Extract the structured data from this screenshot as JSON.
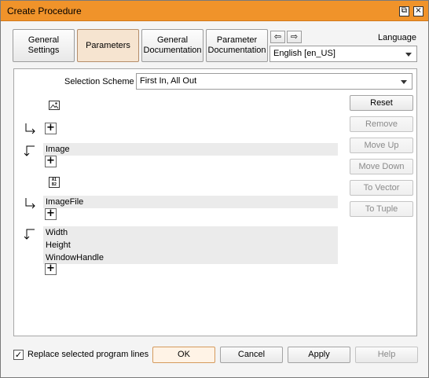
{
  "window": {
    "title": "Create Procedure",
    "accent_color": "#f0932a"
  },
  "titlebar_icons": [
    "restore-icon",
    "close-icon"
  ],
  "tabs": [
    {
      "label": "General Settings",
      "active": false
    },
    {
      "label": "Parameters",
      "active": true
    },
    {
      "label": "General Documentation",
      "active": false
    },
    {
      "label": "Parameter Documentation",
      "active": false
    }
  ],
  "nav": {
    "back_glyph": "⇦",
    "forward_glyph": "⇨"
  },
  "language": {
    "label": "Language",
    "value": "English [en_US]"
  },
  "selection_scheme": {
    "label": "Selection Scheme",
    "value": "First In, All Out"
  },
  "params": {
    "iconic_input": [],
    "iconic_output": [
      "Image"
    ],
    "control_input": [
      "ImageFile"
    ],
    "control_output": [
      "Width",
      "Height",
      "WindowHandle"
    ]
  },
  "side_buttons": {
    "reset": "Reset",
    "remove": "Remove",
    "move_up": "Move Up",
    "move_down": "Move Down",
    "to_vector": "To Vector",
    "to_tuple": "To Tuple"
  },
  "footer": {
    "replace_label": "Replace selected program lines",
    "replace_checked": true,
    "ok": "OK",
    "cancel": "Cancel",
    "apply": "Apply",
    "help": "Help"
  }
}
